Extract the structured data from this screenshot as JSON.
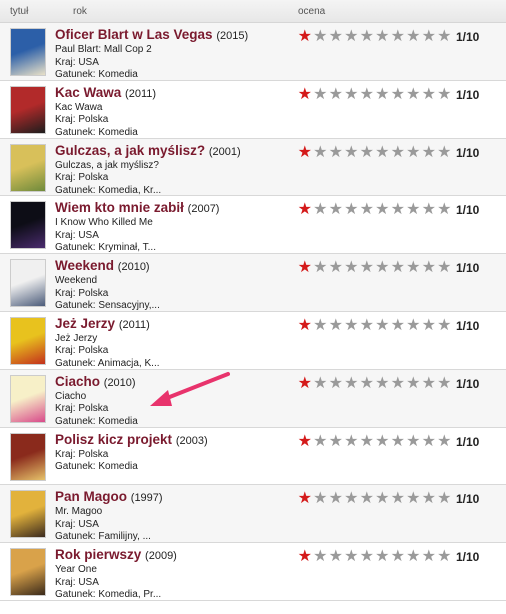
{
  "header": {
    "col_title": "tytuł",
    "col_year": "rok",
    "col_rating": "ocena"
  },
  "films": [
    {
      "title": "Oficer Blart w Las Vegas",
      "year": "(2015)",
      "line1": "Paul Blart: Mall Cop 2",
      "line2": "Kraj: USA",
      "line3": "Gatunek: Komedia",
      "rating": 1,
      "score": "1/10",
      "poster_colors": [
        "#2c5fa8",
        "#e9e1c8"
      ]
    },
    {
      "title": "Kac Wawa",
      "year": "(2011)",
      "line1": "Kac Wawa",
      "line2": "Kraj: Polska",
      "line3": "Gatunek: Komedia",
      "rating": 1,
      "score": "1/10",
      "poster_colors": [
        "#b22a2a",
        "#1d1d1d"
      ]
    },
    {
      "title": "Gulczas, a jak myślisz?",
      "year": "(2001)",
      "line1": "Gulczas, a jak myślisz?",
      "line2": "Kraj: Polska",
      "line3": "Gatunek: Komedia, Kr...",
      "rating": 1,
      "score": "1/10",
      "poster_colors": [
        "#d8c05a",
        "#6f8a3b"
      ]
    },
    {
      "title": "Wiem kto mnie zabił",
      "year": "(2007)",
      "line1": "I Know Who Killed Me",
      "line2": "Kraj: USA",
      "line3": "Gatunek: Kryminał, T...",
      "rating": 1,
      "score": "1/10",
      "poster_colors": [
        "#0d0d16",
        "#4a2b6e"
      ]
    },
    {
      "title": "Weekend",
      "year": "(2010)",
      "line1": "Weekend",
      "line2": "Kraj: Polska",
      "line3": "Gatunek: Sensacyjny,...",
      "rating": 1,
      "score": "1/10",
      "poster_colors": [
        "#f0f0f0",
        "#4b5b7a"
      ]
    },
    {
      "title": "Jeż Jerzy",
      "year": "(2011)",
      "line1": "Jeż Jerzy",
      "line2": "Kraj: Polska",
      "line3": "Gatunek: Animacja, K...",
      "rating": 1,
      "score": "1/10",
      "poster_colors": [
        "#e8c21e",
        "#c3301c"
      ]
    },
    {
      "title": "Ciacho",
      "year": "(2010)",
      "line1": "Ciacho",
      "line2": "Kraj: Polska",
      "line3": "Gatunek: Komedia",
      "rating": 1,
      "score": "1/10",
      "poster_colors": [
        "#f7f0c8",
        "#d84a8a"
      ]
    },
    {
      "title": "Polisz kicz projekt",
      "year": "(2003)",
      "line1": "Kraj: Polska",
      "line2": "Gatunek: Komedia",
      "line3": "",
      "rating": 1,
      "score": "1/10",
      "poster_colors": [
        "#8a2a1c",
        "#e6c26a"
      ]
    },
    {
      "title": "Pan Magoo",
      "year": "(1997)",
      "line1": "Mr. Magoo",
      "line2": "Kraj: USA",
      "line3": "Gatunek: Familijny, ...",
      "rating": 1,
      "score": "1/10",
      "poster_colors": [
        "#e2b23c",
        "#3b2a1e"
      ]
    },
    {
      "title": "Rok pierwszy",
      "year": "(2009)",
      "line1": "Year One",
      "line2": "Kraj: USA",
      "line3": "Gatunek: Komedia, Pr...",
      "rating": 1,
      "score": "1/10",
      "poster_colors": [
        "#d9a24a",
        "#3a2a1a"
      ]
    }
  ],
  "annotation": {
    "arrow_color": "#e8336c"
  }
}
